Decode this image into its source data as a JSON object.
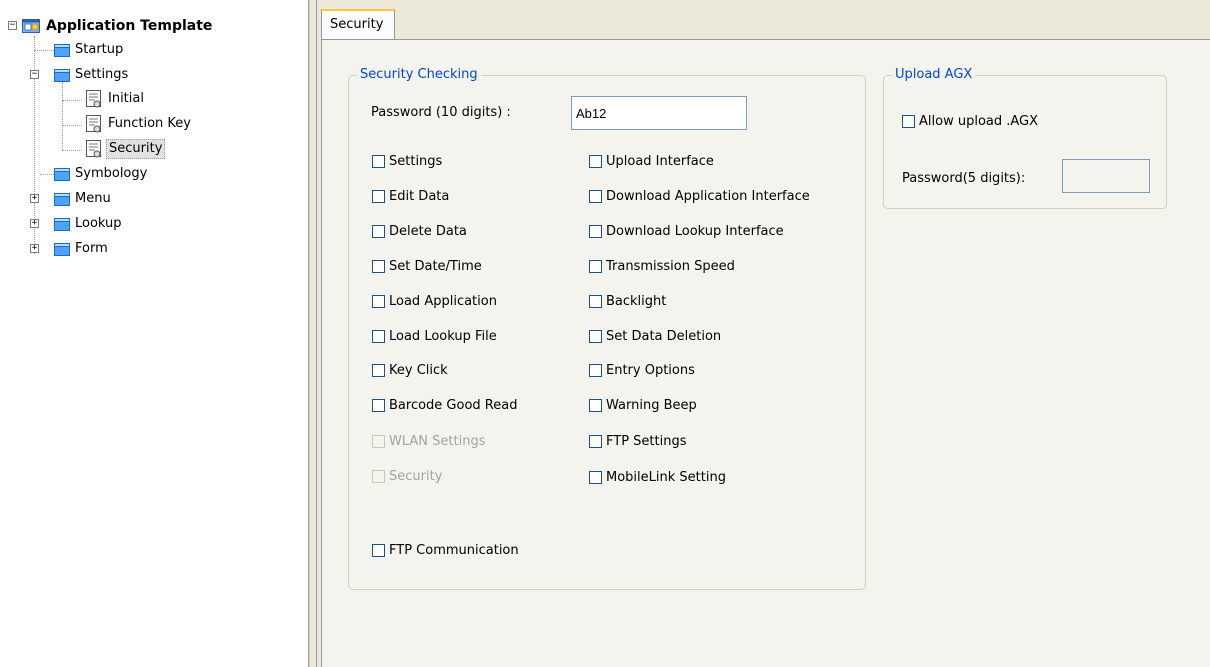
{
  "tree": {
    "root": {
      "label": "Application Template",
      "expander": "−"
    },
    "items": [
      {
        "label": "Startup"
      },
      {
        "label": "Settings",
        "expander": "−"
      },
      {
        "label": "Initial"
      },
      {
        "label": "Function Key"
      },
      {
        "label": "Security",
        "selected": true
      },
      {
        "label": "Symbology"
      },
      {
        "label": "Menu",
        "expander": "+"
      },
      {
        "label": "Lookup",
        "expander": "+"
      },
      {
        "label": "Form",
        "expander": "+"
      }
    ]
  },
  "tabs": [
    {
      "label": "Security",
      "active": true
    }
  ],
  "security_checking": {
    "title": "Security Checking",
    "password_label": "Password (10 digits) :",
    "password_value": "Ab12",
    "left_checkboxes": [
      {
        "label": "Settings",
        "checked": false,
        "enabled": true
      },
      {
        "label": "Edit Data",
        "checked": false,
        "enabled": true
      },
      {
        "label": "Delete Data",
        "checked": false,
        "enabled": true
      },
      {
        "label": "Set Date/Time",
        "checked": false,
        "enabled": true
      },
      {
        "label": "Load Application",
        "checked": false,
        "enabled": true
      },
      {
        "label": "Load Lookup File",
        "checked": false,
        "enabled": true
      },
      {
        "label": "Key Click",
        "checked": false,
        "enabled": true
      },
      {
        "label": "Barcode Good Read",
        "checked": false,
        "enabled": true
      },
      {
        "label": "WLAN Settings",
        "checked": false,
        "enabled": false
      },
      {
        "label": "Security",
        "checked": false,
        "enabled": false
      }
    ],
    "right_checkboxes": [
      {
        "label": "Upload Interface",
        "checked": false,
        "enabled": true
      },
      {
        "label": "Download Application Interface",
        "checked": false,
        "enabled": true
      },
      {
        "label": "Download Lookup Interface",
        "checked": false,
        "enabled": true
      },
      {
        "label": "Transmission Speed",
        "checked": false,
        "enabled": true
      },
      {
        "label": "Backlight",
        "checked": false,
        "enabled": true
      },
      {
        "label": "Set Data Deletion",
        "checked": false,
        "enabled": true
      },
      {
        "label": "Entry Options",
        "checked": false,
        "enabled": true
      },
      {
        "label": "Warning Beep",
        "checked": false,
        "enabled": true
      },
      {
        "label": "FTP Settings",
        "checked": false,
        "enabled": true
      },
      {
        "label": "MobileLink Setting",
        "checked": false,
        "enabled": true
      }
    ],
    "ftp_communication": {
      "label": "FTP Communication",
      "checked": false,
      "enabled": true
    }
  },
  "upload_agx": {
    "title": "Upload AGX",
    "allow_label": "Allow upload .AGX",
    "allow_checked": false,
    "password_label": "Password(5 digits):",
    "password_value": ""
  },
  "colors": {
    "group_title": "#0046d5",
    "panel_background": "#ece9d8",
    "tab_highlight": "#ffc83c"
  }
}
